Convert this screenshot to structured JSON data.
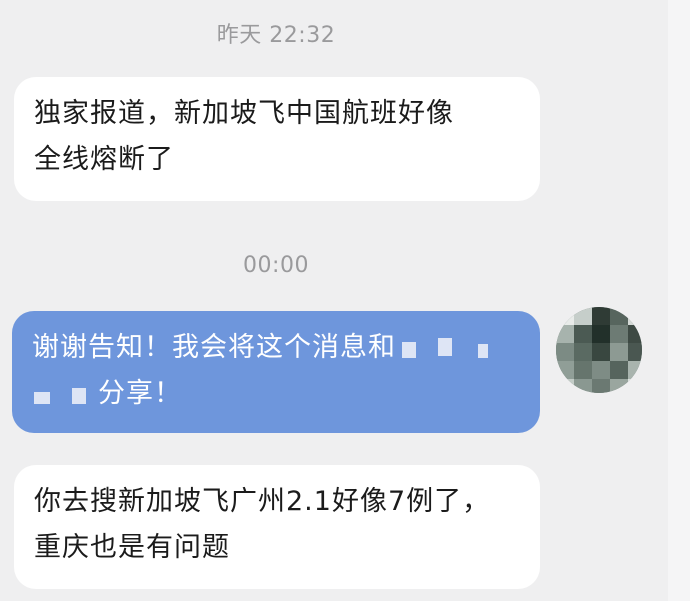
{
  "conversation": {
    "timestamps": [
      {
        "text": "昨天 22:32"
      },
      {
        "text": "00:00"
      }
    ],
    "messages": [
      {
        "direction": "incoming",
        "lines": [
          "独家报道，新加坡飞中国航班好像",
          "全线熔断了"
        ]
      },
      {
        "direction": "outgoing",
        "line1": "谢谢告知！我会将这个消息和",
        "line2": "分享！",
        "redacted": true
      },
      {
        "direction": "incoming",
        "lines": [
          "你去搜新加坡飞广州2.1好像7例了，",
          "重庆也是有问题"
        ]
      }
    ]
  },
  "colors": {
    "background": "#efeff0",
    "incoming_bubble": "#ffffff",
    "outgoing_bubble": "#6e96dc",
    "timestamp_text": "#9a9a9c"
  },
  "icons": {
    "avatar": "pixelated-user-avatar"
  }
}
